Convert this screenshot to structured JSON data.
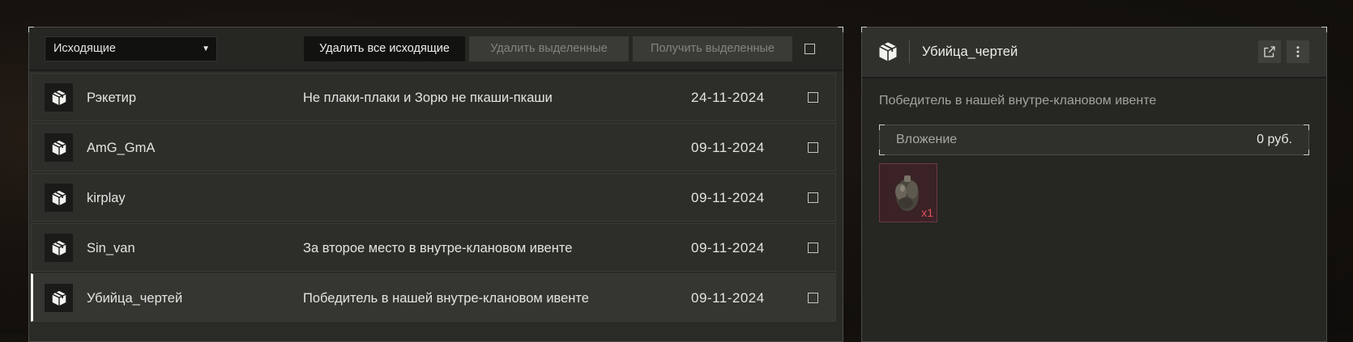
{
  "toolbar": {
    "filter_value": "Исходящие",
    "delete_all_label": "Удалить все исходящие",
    "delete_selected_label": "Удалить выделенные",
    "get_selected_label": "Получить выделенные"
  },
  "rows": [
    {
      "sender": "Рэкетир",
      "message": "Не плаки-плаки и Зорю не пкаши-пкаши",
      "date": "24-11-2024",
      "selected": false
    },
    {
      "sender": "AmG_GmA",
      "message": "",
      "date": "09-11-2024",
      "selected": false
    },
    {
      "sender": "kirplay",
      "message": "",
      "date": "09-11-2024",
      "selected": false
    },
    {
      "sender": "Sin_van",
      "message": "За второе место в внутре-клановом ивенте",
      "date": "09-11-2024",
      "selected": false
    },
    {
      "sender": "Убийца_чертей",
      "message": "Победитель в нашей внутре-клановом ивенте",
      "date": "09-11-2024",
      "selected": true
    }
  ],
  "detail": {
    "title": "Убийца_чертей",
    "message": "Победитель в нашей внутре-клановом ивенте",
    "attachment_label": "Вложение",
    "attachment_value": "0 руб.",
    "item_qty": "x1",
    "item_icon": "grenade-pouch-icon"
  },
  "icons": {
    "package": "package-icon",
    "open_external": "external-link-icon",
    "more": "more-vertical-icon",
    "dropdown": "chevron-down-icon"
  }
}
